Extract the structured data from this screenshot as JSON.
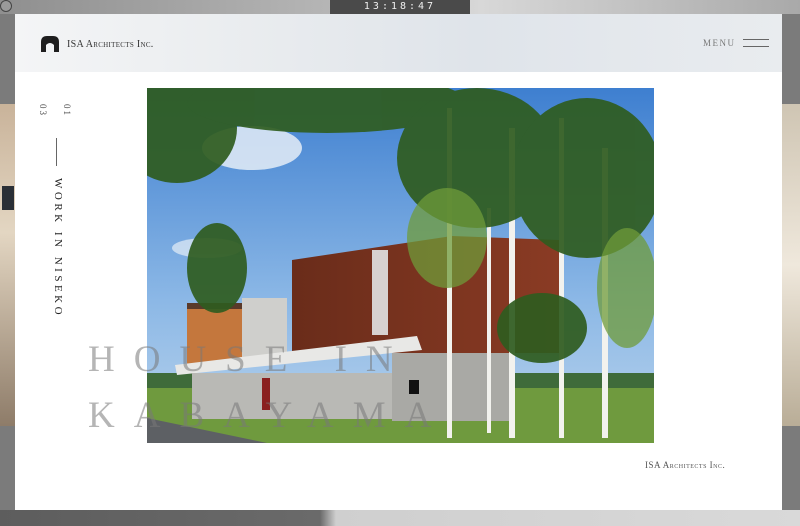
{
  "clock": {
    "time": "13:18:47"
  },
  "header": {
    "brand": "ISA Architects Inc.",
    "menu_label": "MENU"
  },
  "work_index": {
    "current": "01",
    "total": "03"
  },
  "work_title": "WORK IN NISEKO",
  "project_title": {
    "line1": "HOUSE IN",
    "line2": "KABAYAMA"
  },
  "footer": {
    "credit": "ISA Architects Inc."
  },
  "icons": [
    "logo-mark-icon",
    "hamburger-menu-icon"
  ],
  "colors": {
    "accent": "#7a3a24",
    "text": "#333333",
    "header_bg": "#e6e9ec"
  }
}
